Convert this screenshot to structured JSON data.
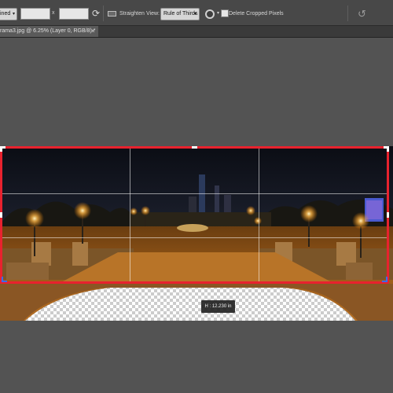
{
  "options_bar": {
    "ratio_select_value": "ined",
    "width_value": "",
    "swap_symbol": "x",
    "height_value": "",
    "straighten_label": "Straighten",
    "view_label": "View:",
    "view_select_value": "Rule of Thirds",
    "delete_cropped_label": "Delete Cropped Pixels",
    "delete_cropped_checked": false
  },
  "document_tab": {
    "title": "rama3.jpg @ 6.25% (Layer 0, RGB/8) *",
    "close_symbol": "×"
  },
  "canvas": {
    "crop_dimension_readout": "H :  12.230 in"
  },
  "icons": {
    "rotate_icon": "rotate-cw-icon",
    "straighten_icon": "straighten-icon",
    "gear_icon": "gear-icon",
    "reset_icon": "reset-icon"
  },
  "colors": {
    "crop_border": "#e8222e",
    "ui_background": "#535353",
    "options_bar": "#484848"
  }
}
